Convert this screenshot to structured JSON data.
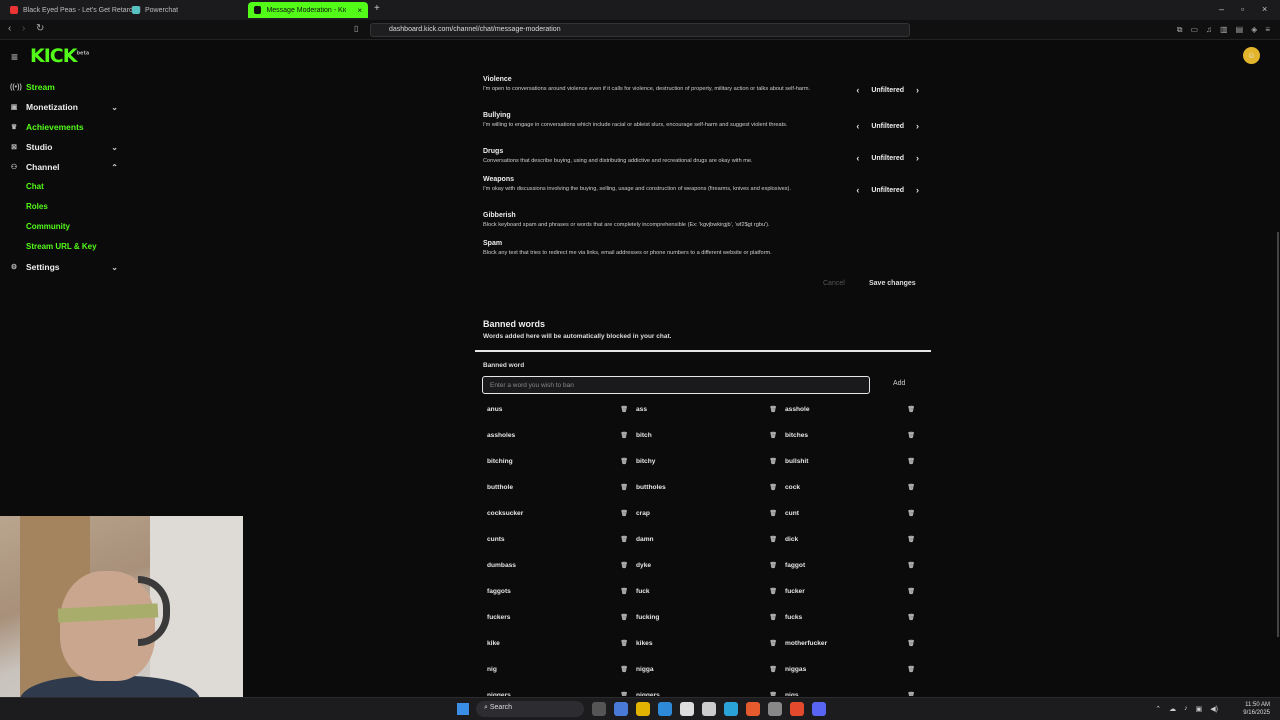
{
  "browser": {
    "tabs": [
      {
        "title": "Black Eyed Peas - Let's Get Retarded",
        "color": "#e33"
      },
      {
        "title": "Powerchat",
        "color": "#56c2c2"
      },
      {
        "title": "Message Moderation - Kick Das",
        "color": "#53fc18"
      }
    ],
    "url": "dashboard.kick.com/channel/chat/message-moderation"
  },
  "app": {
    "logo": "KICK",
    "logo_sup": "beta"
  },
  "sidebar": {
    "items": [
      {
        "label": "Stream",
        "icon": "stream-icon"
      },
      {
        "label": "Monetization",
        "icon": "monetization-icon"
      },
      {
        "label": "Achievements",
        "icon": "trophy-icon"
      },
      {
        "label": "Studio",
        "icon": "studio-icon"
      },
      {
        "label": "Channel",
        "icon": "channel-icon"
      },
      {
        "label": "Settings",
        "icon": "gear-icon"
      }
    ],
    "channel_sub": [
      "Chat",
      "Roles",
      "Community",
      "Stream URL & Key"
    ]
  },
  "moderation": [
    {
      "title": "Violence",
      "desc": "I'm open to conversations around violence even if it calls for violence, destruction of property, military action or talks about self-harm.",
      "value": "Unfiltered"
    },
    {
      "title": "Bullying",
      "desc": "I'm willing to engage in conversations which include racial or ableist slurs, encourage self-harm and suggest violent threats.",
      "value": "Unfiltered"
    },
    {
      "title": "Drugs",
      "desc": "Conversations that describe buying, using and distributing addictive and recreational drugs are okay with me.",
      "value": "Unfiltered"
    },
    {
      "title": "Weapons",
      "desc": "I'm okay with discussions involving the buying, selling, usage and construction of weapons (firearms, knives and explosives).",
      "value": "Unfiltered"
    },
    {
      "title": "Gibberish",
      "desc": "Block keyboard spam and phrases or words that are completely incomprehensible (Ex: 'kgvjbwkirgjb', 'wf2$gt rgbu').",
      "value": ""
    },
    {
      "title": "Spam",
      "desc": "Block any text that tries to redirect me via links, email addresses or phone numbers to a different website or platform.",
      "value": ""
    }
  ],
  "actions": {
    "cancel": "Cancel",
    "save": "Save changes"
  },
  "banned": {
    "title": "Banned words",
    "subtitle": "Words added here will be automatically blocked in your chat.",
    "label": "Banned word",
    "placeholder": "Enter a word you wish to ban",
    "add": "Add",
    "words": [
      "anus",
      "ass",
      "asshole",
      "assholes",
      "bitch",
      "bitches",
      "bitching",
      "bitchy",
      "bullshit",
      "butthole",
      "buttholes",
      "cock",
      "cocksucker",
      "crap",
      "cunt",
      "cunts",
      "damn",
      "dick",
      "dumbass",
      "dyke",
      "faggot",
      "faggots",
      "fuck",
      "fucker",
      "fuckers",
      "fucking",
      "fucks",
      "kike",
      "kikes",
      "motherfucker",
      "nig",
      "nigga",
      "niggas",
      "niggers",
      "niggers",
      "nigs"
    ]
  },
  "taskbar": {
    "search": "Search",
    "time": "11:50 AM",
    "date": "9/16/2025"
  }
}
